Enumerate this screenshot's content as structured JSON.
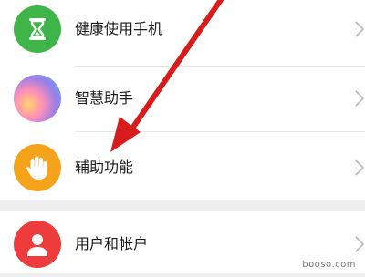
{
  "settings_list": {
    "items": [
      {
        "label": "健康使用手机",
        "icon": "hourglass-icon",
        "icon_color": "#3fb549"
      },
      {
        "label": "智慧助手",
        "icon": "gradient-orb-icon",
        "icon_color": "#8f7de6"
      },
      {
        "label": "辅助功能",
        "icon": "hand-icon",
        "icon_color": "#f5a31a"
      },
      {
        "label": "用户和帐户",
        "icon": "user-icon",
        "icon_color": "#ee3b3b"
      }
    ]
  },
  "annotation": {
    "arrow_color": "#d81b1b"
  },
  "watermark": {
    "text": "booso.com"
  }
}
